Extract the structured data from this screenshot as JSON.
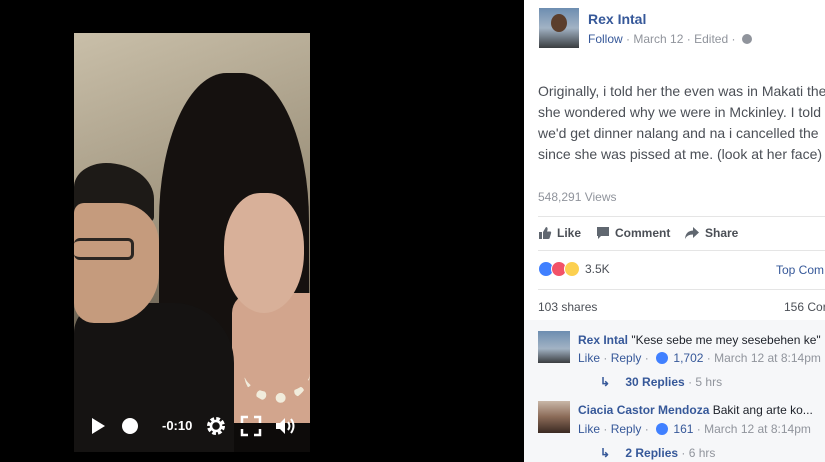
{
  "video": {
    "time": "-0:10",
    "controls": [
      "play-icon",
      "scrub-dot",
      "gear-icon",
      "fullscreen-icon",
      "volume-icon"
    ]
  },
  "post": {
    "author": "Rex Intal",
    "follow": "Follow",
    "date": "March 12",
    "edited": "Edited",
    "lines": [
      "Originally, i told her the even was in Makati the",
      "she wondered why we were in Mckinley. I told",
      "we'd get dinner nalang and na i cancelled the",
      "since she was pissed at me. (look at her face)"
    ],
    "views": "548,291 Views",
    "actions": {
      "like": "Like",
      "comment": "Comment",
      "share": "Share"
    },
    "reactions": {
      "count": "3.5K",
      "icons": [
        "like-icon",
        "love-icon",
        "haha-icon"
      ]
    },
    "top_comments": "Top Com",
    "shares": "103 shares",
    "comment_total": "156 Cor"
  },
  "comments": [
    {
      "author": "Rex Intal",
      "text": "\"Kese sebe me mey sesebehen ke\"",
      "like": "Like",
      "reply": "Reply",
      "likes": "1,702",
      "time": "March 12 at 8:14pm",
      "replies": "30 Replies",
      "replies_time": "5 hrs"
    },
    {
      "author": "Ciacia Castor Mendoza",
      "text": "Bakit ang arte ko...",
      "like": "Like",
      "reply": "Reply",
      "likes": "161",
      "time": "March 12 at 8:14pm",
      "replies": "2 Replies",
      "replies_time": "6 hrs"
    }
  ],
  "colors": {
    "link": "#365899",
    "muted": "#90949c",
    "text": "#4b4f56",
    "like_blue": "#4080ff",
    "love_red": "#f25268",
    "haha_yellow": "#fcd050"
  }
}
